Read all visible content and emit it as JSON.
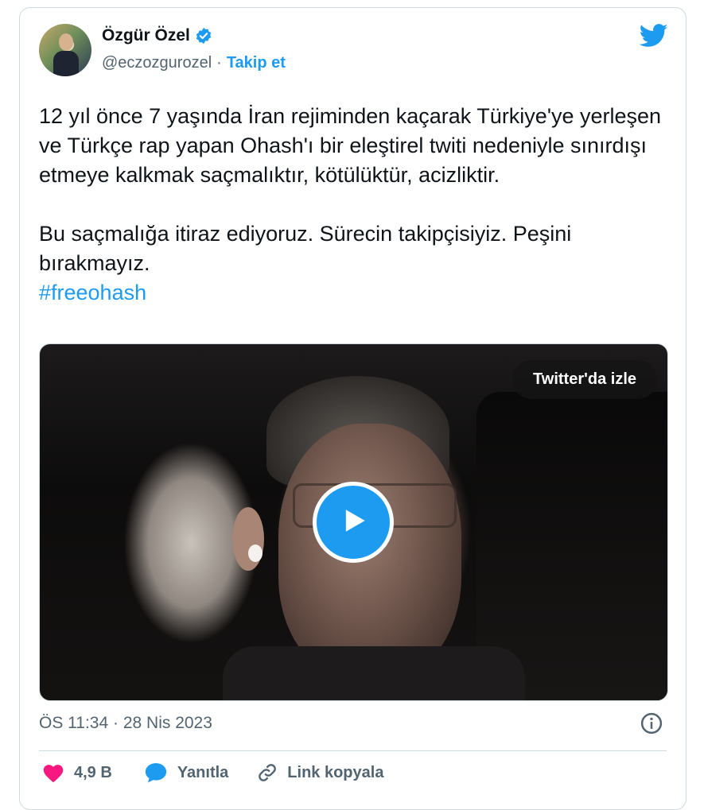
{
  "author": {
    "name": "Özgür Özel",
    "handle": "@eczozgurozel",
    "separator": "·",
    "follow_label": "Takip et"
  },
  "tweet": {
    "paragraph1": "12 yıl önce 7 yaşında İran rejiminden kaçarak Türkiye'ye yerleşen ve Türkçe rap yapan Ohash'ı bir eleştirel twiti nedeniyle sınırdışı etmeye kalkmak saçmalıktır, kötülüktür, acizliktir.",
    "paragraph2": "Bu saçmalığa itiraz ediyoruz. Sürecin takipçisiyiz. Peşini bırakmayız.",
    "hashtag": "#freeohash"
  },
  "media": {
    "watch_label": "Twitter'da izle"
  },
  "meta": {
    "timestamp": "ÖS 11:34 · 28 Nis 2023"
  },
  "actions": {
    "like_count": "4,9 B",
    "reply_label": "Yanıtla",
    "copy_link_label": "Link kopyala"
  },
  "colors": {
    "accent": "#1d9bf0",
    "like": "#f91880",
    "secondary_text": "#536471"
  },
  "icons": [
    "verified-badge-icon",
    "twitter-bird-icon",
    "play-icon",
    "info-icon",
    "heart-icon",
    "reply-bubble-icon",
    "link-icon"
  ]
}
